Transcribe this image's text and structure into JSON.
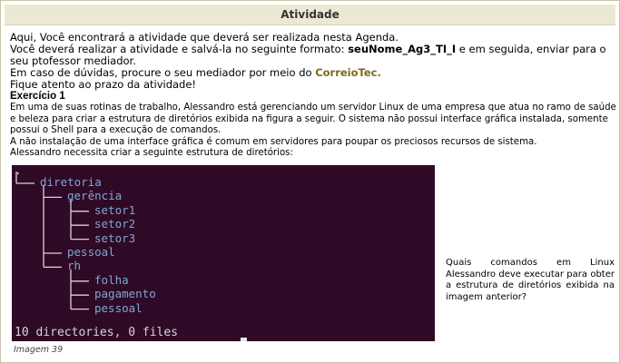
{
  "header": {
    "title": "Atividade"
  },
  "intro": {
    "line1": "Aqui, Você encontrará a atividade que deverá ser realizada nesta Agenda.",
    "line2_prefix": "Você deverá realizar a atividade e salvá-la no seguinte formato: ",
    "line2_bold": "seuNome_Ag3_TI_I",
    "line2_suffix": " e em seguida, enviar para o seu ptofessor mediador.",
    "line3_prefix": "Em caso de dúvidas, procure o seu mediador por meio do ",
    "line3_link": "CorreioTec.",
    "line4": "Fique atento ao prazo da atividade!"
  },
  "exercise": {
    "title": "Exercício 1",
    "para1": "Em uma de suas rotinas de trabalho, Alessandro está gerenciando um servidor Linux de uma empresa que atua no ramo de saúde e beleza para criar a estrutura de diretórios exibida na figura a seguir. O sistema não possui interface gráfica instalada, somente possui o Shell para a execução de comandos.",
    "para2": "A não instalação de uma interface gráfica é comum em servidores para poupar os preciosos recursos de sistema.",
    "para3": "Alessandro necessita criar a seguinte estrutura de diretórios:"
  },
  "terminal": {
    "root": ".",
    "tree": [
      {
        "name": "diretoria",
        "depth": 0
      },
      {
        "name": "gerência",
        "depth": 1
      },
      {
        "name": "setor1",
        "depth": 2
      },
      {
        "name": "setor2",
        "depth": 2
      },
      {
        "name": "setor3",
        "depth": 2
      },
      {
        "name": "pessoal",
        "depth": 1
      },
      {
        "name": "rh",
        "depth": 1
      },
      {
        "name": "folha",
        "depth": 2
      },
      {
        "name": "pagamento",
        "depth": 2
      },
      {
        "name": "pessoal",
        "depth": 2
      }
    ],
    "summary": "10 directories, 0 files",
    "background": "#2f0a27",
    "dir_color": "#7fa7d1"
  },
  "caption": "Imagem 39",
  "question": "Quais comandos em Linux Alessandro deve executar para obter a estrutura de diretórios exibida na imagem anterior?"
}
